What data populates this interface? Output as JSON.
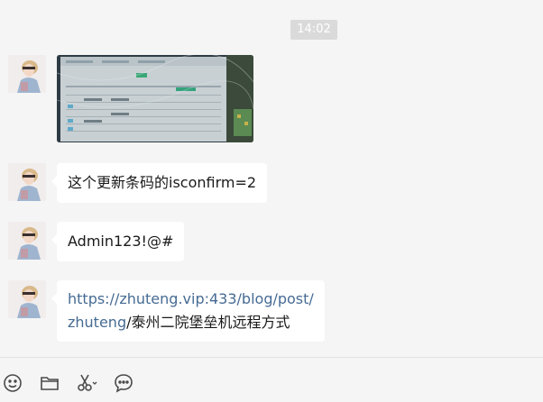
{
  "chat": {
    "timestamp": "14:02",
    "messages": [
      {
        "type": "image"
      },
      {
        "type": "text",
        "text": "这个更新条码的isconfirm=2"
      },
      {
        "type": "text",
        "text": "Admin123!@#"
      },
      {
        "type": "link",
        "link_line1": "https://zhuteng.vip:433/blog/post/",
        "link_line2_url": "zhuteng",
        "link_line2_rest": "/泰州二院堡垒机远程方式"
      }
    ]
  },
  "toolbar": {
    "icons": [
      "emoji-icon",
      "folder-icon",
      "scissors-icon",
      "chat-bubble-icon"
    ]
  },
  "colors": {
    "background": "#f5f5f5",
    "bubble": "#ffffff",
    "link": "#466b94",
    "timestamp_bg": "#dadada"
  }
}
